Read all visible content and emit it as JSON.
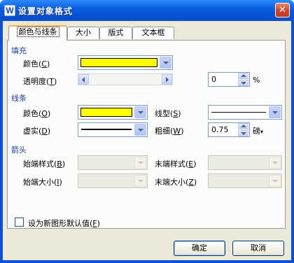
{
  "window": {
    "title": "设置对象格式",
    "app_icon": "wps-writer-icon",
    "close_glyph": "✕"
  },
  "tabs": [
    {
      "label": "颜色与线条",
      "active": true
    },
    {
      "label": "大小",
      "active": false
    },
    {
      "label": "版式",
      "active": false
    },
    {
      "label": "文本框",
      "active": false
    }
  ],
  "fill": {
    "section_title": "填充",
    "color_label": "颜色",
    "color_key": "C",
    "color_value": "#ffff00",
    "transparency_label": "透明度",
    "transparency_key": "T",
    "transparency_value": "0",
    "transparency_unit": "%",
    "transparency_fraction": 0
  },
  "line": {
    "section_title": "线条",
    "color_label": "颜色",
    "color_key": "O",
    "color_value": "#ffff00",
    "style_label": "线型",
    "style_key": "S",
    "dash_label": "虚实",
    "dash_key": "D",
    "weight_label": "粗细",
    "weight_key": "W",
    "weight_value": "0.75",
    "weight_unit": "磅"
  },
  "arrows": {
    "section_title": "箭头",
    "begin_style_label": "始端样式",
    "begin_style_key": "B",
    "end_style_label": "末端样式",
    "end_style_key": "E",
    "begin_size_label": "始端大小",
    "begin_size_key": "I",
    "end_size_label": "末端大小",
    "end_size_key": "Z"
  },
  "default_checkbox": {
    "label": "设为新图形默认值",
    "key": "F",
    "checked": false
  },
  "buttons": {
    "ok": "确定",
    "cancel": "取消"
  },
  "colors": {
    "accent": "#1a3fa6",
    "title_bar": "#0a5ee3",
    "dialog_bg": "#ece9d8"
  }
}
